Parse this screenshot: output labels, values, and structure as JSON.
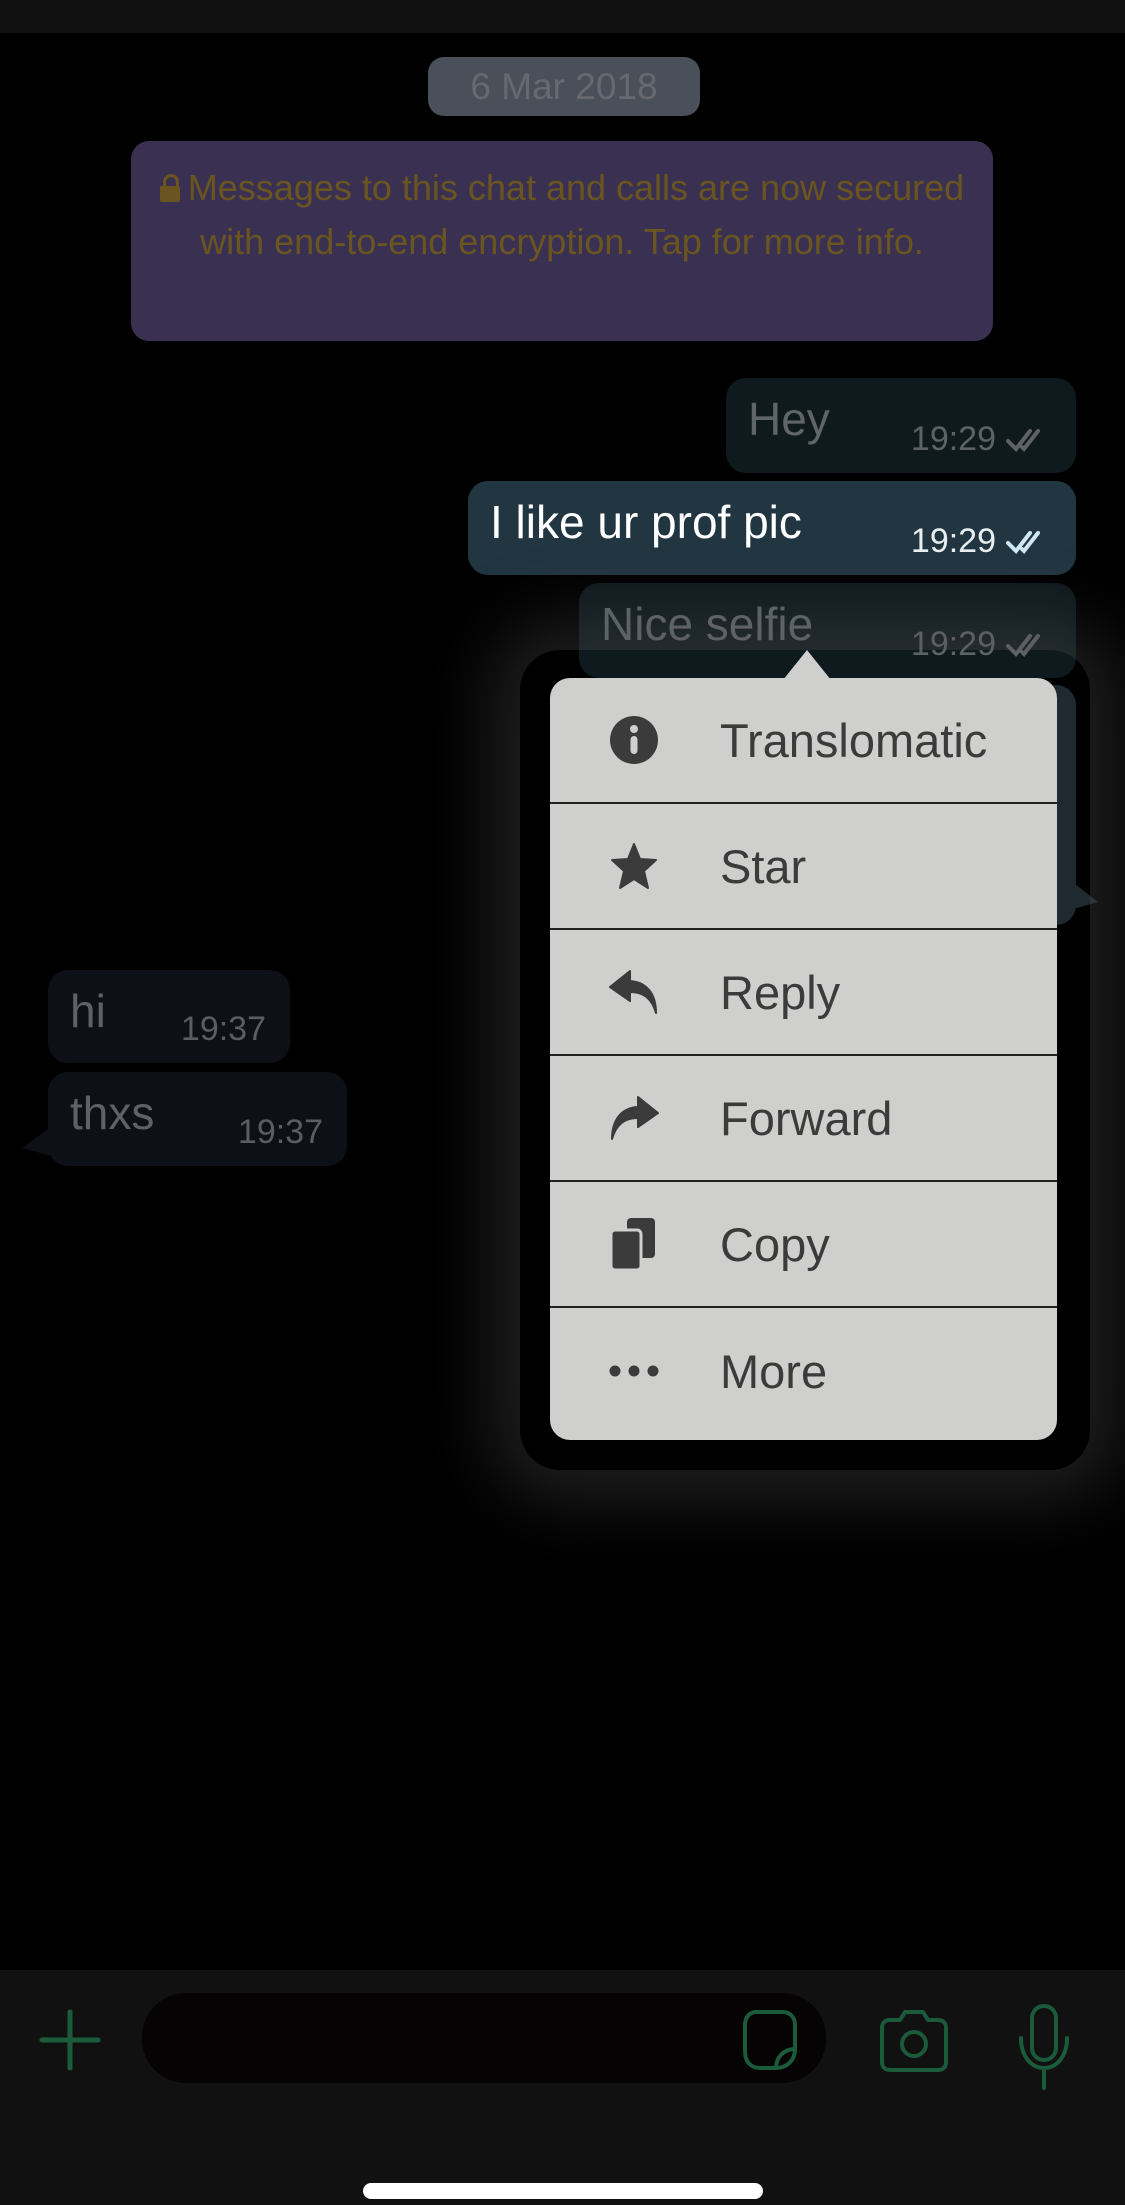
{
  "conversation": {
    "date_label": "6 Mar 2018",
    "encryption_notice": "Messages to this chat and calls are now secured with end-to-end encryption. Tap for more info.",
    "messages": [
      {
        "direction": "outgoing",
        "text": "Hey",
        "time": "19:29",
        "status": "read",
        "highlighted": false
      },
      {
        "direction": "outgoing",
        "text": "I like ur prof pic",
        "time": "19:29",
        "status": "read",
        "highlighted": true
      },
      {
        "direction": "outgoing",
        "text": "Nice selfie",
        "time": "19:29",
        "status": "read",
        "highlighted": false
      },
      {
        "direction": "incoming",
        "text": "hi",
        "time": "19:37"
      },
      {
        "direction": "incoming",
        "text": "thxs",
        "time": "19:37"
      }
    ]
  },
  "context_menu": {
    "items": [
      {
        "label": "Translomatic",
        "icon": "info-icon"
      },
      {
        "label": "Star",
        "icon": "star-icon"
      },
      {
        "label": "Reply",
        "icon": "reply-icon"
      },
      {
        "label": "Forward",
        "icon": "forward-icon"
      },
      {
        "label": "Copy",
        "icon": "copy-icon"
      },
      {
        "label": "More",
        "icon": "more-icon"
      }
    ]
  },
  "composer": {
    "message_value": "",
    "icons": [
      "plus-icon",
      "sticker-icon",
      "camera-icon",
      "microphone-icon"
    ]
  },
  "colors": {
    "accent_green": "#1b5a3a",
    "read_check": "#cfe8f2",
    "highlight_bubble": "#223642"
  }
}
